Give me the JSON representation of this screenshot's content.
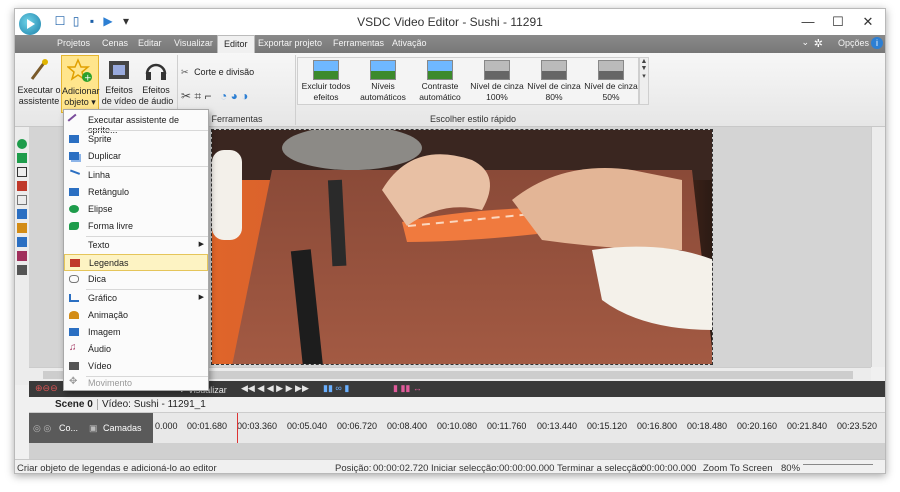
{
  "window": {
    "title": "VSDC Video Editor - Sushi - 11291"
  },
  "menu": {
    "items": [
      "Projetos",
      "Cenas",
      "Editar",
      "Visualizar",
      "Editor",
      "Exportar projeto",
      "Ferramentas",
      "Ativação"
    ],
    "active": "Editor",
    "options_label": "Opções"
  },
  "ribbon": {
    "wizard_label_1": "Executar o",
    "wizard_label_2": "assistente",
    "add_object_1": "Adicionar",
    "add_object_2": "objeto",
    "video_effects_1": "Efeitos",
    "video_effects_2": "de vídeo",
    "audio_effects_1": "Efeitos",
    "audio_effects_2": "de áudio",
    "cut_split": "Corte e divisão",
    "tools_group": "Ferramentas",
    "quick_style_group": "Escolher estilo rápido",
    "quick_styles": [
      {
        "line1": "Excluir todos",
        "line2": "efeitos",
        "gray": false
      },
      {
        "line1": "Níveis",
        "line2": "automáticos",
        "gray": false
      },
      {
        "line1": "Contraste",
        "line2": "automático",
        "gray": false
      },
      {
        "line1": "Nível de cinza",
        "line2": "100%",
        "gray": true
      },
      {
        "line1": "Nível de cinza",
        "line2": "80%",
        "gray": true
      },
      {
        "line1": "Nível de cinza",
        "line2": "50%",
        "gray": true
      }
    ]
  },
  "dropdown": {
    "items": [
      {
        "label": "Executar assistente de sprite...",
        "icon": "wand-icon",
        "color": "#7a4d9c"
      },
      {
        "label": "Sprite",
        "icon": "sprite-icon",
        "color": "#2b6fc2"
      },
      {
        "label": "Duplicar",
        "icon": "duplicate-icon",
        "color": "#2b6fc2"
      },
      {
        "label": "Linha",
        "icon": "line-icon",
        "color": "#2b6fc2"
      },
      {
        "label": "Retângulo",
        "icon": "rectangle-icon",
        "color": "#2b6fc2"
      },
      {
        "label": "Elipse",
        "icon": "ellipse-icon",
        "color": "#1e9c4b"
      },
      {
        "label": "Forma livre",
        "icon": "freeform-icon",
        "color": "#1e9c4b"
      },
      {
        "label": "Texto",
        "icon": "text-icon",
        "color": "#444444"
      },
      {
        "label": "Legendas",
        "icon": "subtitles-icon",
        "color": "#c0392b"
      },
      {
        "label": "Dica",
        "icon": "hint-icon",
        "color": "#777777"
      },
      {
        "label": "Gráfico",
        "icon": "chart-icon",
        "color": "#2b6fc2"
      },
      {
        "label": "Animação",
        "icon": "animation-icon",
        "color": "#d38c16"
      },
      {
        "label": "Imagem",
        "icon": "image-icon",
        "color": "#2b6fc2"
      },
      {
        "label": "Áudio",
        "icon": "audio-icon",
        "color": "#a0305c"
      },
      {
        "label": "Vídeo",
        "icon": "video-icon",
        "color": "#555555"
      },
      {
        "label": "Movimento",
        "icon": "movement-icon",
        "color": "#999999"
      }
    ]
  },
  "preview": {
    "label": "Visualizar"
  },
  "scene": {
    "tab": "Scene 0",
    "video_tab": "Vídeo: Sushi - 11291_1"
  },
  "timeline": {
    "track_short": "Co...",
    "layers_label": "Camadas",
    "ticks": [
      "0.000",
      "00:01.680",
      "00:03.360",
      "00:05.040",
      "00:06.720",
      "00:08.400",
      "00:10.080",
      "00:11.760",
      "00:13.440",
      "00:15.120",
      "00:16.800",
      "00:18.480",
      "00:20.160",
      "00:21.840",
      "00:23.520"
    ]
  },
  "status": {
    "hint": "Criar objeto de legendas e adicioná-lo ao editor",
    "position_label": "Posição:",
    "position_value": "00:00:02.720",
    "sel_start_label": "Iniciar selecção:",
    "sel_start_value": "00:00:00.000",
    "sel_end_label": "Terminar a selecção:",
    "sel_end_value": "00:00:00.000",
    "zoom_label": "Zoom To Screen",
    "zoom_value": "80%"
  }
}
